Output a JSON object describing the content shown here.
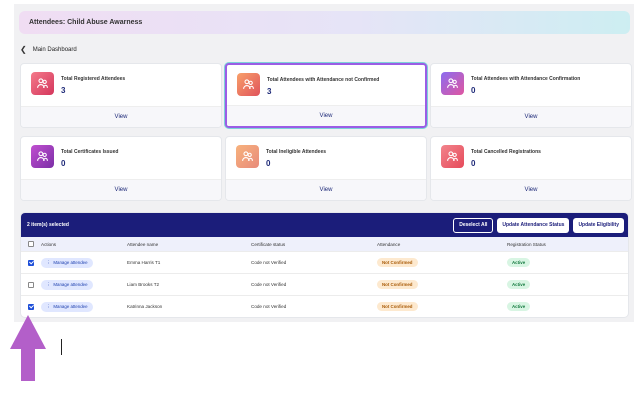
{
  "header": {
    "title": "Attendees: Child Abuse Awarness"
  },
  "breadcrumb": {
    "label": "Main Dashboard"
  },
  "cards": [
    {
      "title": "Total Registered Attendees",
      "value": "3",
      "action": "View"
    },
    {
      "title": "Total Attendees with Attendance not Confirmed",
      "value": "3",
      "action": "View"
    },
    {
      "title": "Total Attendees with Attendance Confirmation",
      "value": "0",
      "action": "View"
    },
    {
      "title": "Total Certificates Issued",
      "value": "0",
      "action": "View"
    },
    {
      "title": "Total Ineligible Attendees",
      "value": "0",
      "action": "View"
    },
    {
      "title": "Total Cancelled Registrations",
      "value": "0",
      "action": "View"
    }
  ],
  "table": {
    "selection_text": "2 item(s) selected",
    "deselect_label": "Deselect All",
    "update_attendance_label": "Update Attendance Status",
    "update_eligibility_label": "Update Eligibility",
    "columns": [
      "Actions",
      "Attendee name",
      "Certificate status",
      "Attendance",
      "Registration Status"
    ],
    "rows": [
      {
        "checked": true,
        "action": "Manage attendee",
        "name": "Emma Harris T1",
        "certificate": "Code not Verified",
        "attendance": "Not Confirmed",
        "registration": "Active"
      },
      {
        "checked": false,
        "action": "Manage attendee",
        "name": "Liam Brooks T2",
        "certificate": "Code not Verified",
        "attendance": "Not Confirmed",
        "registration": "Active"
      },
      {
        "checked": true,
        "action": "Manage attendee",
        "name": "Katrinna Jackson",
        "certificate": "Code not Verified",
        "attendance": "Not Confirmed",
        "registration": "Active"
      }
    ]
  },
  "colors": {
    "accent_navy": "#1b1d7a",
    "arrow": "#b35fc9",
    "active_card_border": "#9b5de5"
  },
  "icons": {
    "card_icon": "users-icon",
    "back": "chevron-left-icon",
    "row_menu": "kebab-menu-icon"
  }
}
